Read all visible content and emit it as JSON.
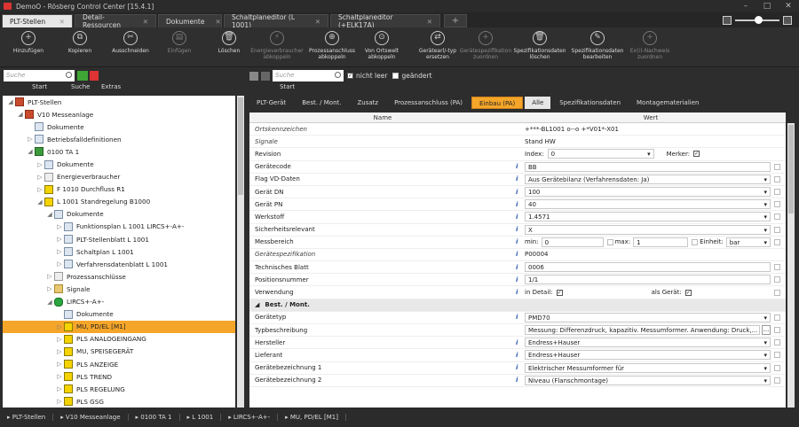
{
  "window": {
    "title": "DemoO - Rösberg Control Center [15.4.1]"
  },
  "tabs": [
    {
      "label": "PLT-Stellen"
    },
    {
      "label": "Detail-Ressourcen"
    },
    {
      "label": "Dokumente"
    },
    {
      "label": "Schaltplaneditor (L 1001)"
    },
    {
      "label": "Schaltplaneditor (+ELK17A)"
    }
  ],
  "toolbar": [
    {
      "label": "Hinzufügen",
      "icon": "plus-icon",
      "enabled": true
    },
    {
      "label": "Kopieren",
      "icon": "copy-icon",
      "enabled": true
    },
    {
      "label": "Ausschneiden",
      "icon": "scissors-icon",
      "enabled": true
    },
    {
      "label": "Einfügen",
      "icon": "paste-icon",
      "enabled": false
    },
    {
      "label": "Löschen",
      "icon": "trash-icon",
      "enabled": true
    },
    {
      "label": "Energieverbraucher abkoppeln",
      "icon": "energy-icon",
      "enabled": false
    },
    {
      "label": "Prozessanschluss abkoppeln",
      "icon": "process-icon",
      "enabled": true
    },
    {
      "label": "Von Ortswelt abkoppeln",
      "icon": "location-icon",
      "enabled": true
    },
    {
      "label": "Gerätearl/-typ ersetzen",
      "icon": "replace-icon",
      "enabled": true
    },
    {
      "label": "Gerätespezifikation zuordnen",
      "icon": "assign-icon",
      "enabled": false
    },
    {
      "label": "Spezifikationsdaten löschen",
      "icon": "spec-delete-icon",
      "enabled": true
    },
    {
      "label": "Spezifikationsdaten bearbeiten",
      "icon": "edit-icon",
      "enabled": true
    },
    {
      "label": "Ex(i)-Nachweis zuordnen",
      "icon": "ex-icon",
      "enabled": false
    }
  ],
  "left": {
    "search_placeholder": "Suche",
    "sub": [
      "Start",
      "Suche",
      "Extras"
    ]
  },
  "tree": [
    {
      "label": "PLT-Stellen",
      "depth": 0,
      "tw": "◢",
      "icon": "ic plant"
    },
    {
      "label": "V10 Messeanlage",
      "depth": 1,
      "tw": "◢",
      "icon": "ic plant"
    },
    {
      "label": "Dokumente",
      "depth": 2,
      "tw": "",
      "icon": "ic doc"
    },
    {
      "label": "Betriebsfalldefinitionen",
      "depth": 2,
      "tw": "▷",
      "icon": "ic doc"
    },
    {
      "label": "0100 TA 1",
      "depth": 2,
      "tw": "◢",
      "icon": "ic grn"
    },
    {
      "label": "Dokumente",
      "depth": 3,
      "tw": "▷",
      "icon": "ic doc"
    },
    {
      "label": "Energieverbraucher",
      "depth": 3,
      "tw": "▷",
      "icon": "ic"
    },
    {
      "label": "F 1010 Durchfluss R1",
      "depth": 3,
      "tw": "▷",
      "icon": "ic yel"
    },
    {
      "label": "L 1001 Standregelung B1000",
      "depth": 3,
      "tw": "◢",
      "icon": "ic yel"
    },
    {
      "label": "Dokumente",
      "depth": 4,
      "tw": "◢",
      "icon": "ic doc"
    },
    {
      "label": "Funktionsplan L 1001  LIRCS+-A+-",
      "depth": 5,
      "tw": "▷",
      "icon": "ic doc"
    },
    {
      "label": "PLT-Stellenblatt L 1001",
      "depth": 5,
      "tw": "▷",
      "icon": "ic doc"
    },
    {
      "label": "Schaltplan L 1001",
      "depth": 5,
      "tw": "▷",
      "icon": "ic doc"
    },
    {
      "label": "Verfahrensdatenblatt L 1001",
      "depth": 5,
      "tw": "▷",
      "icon": "ic doc"
    },
    {
      "label": "Prozessanschlüsse",
      "depth": 4,
      "tw": "▷",
      "icon": "ic"
    },
    {
      "label": "Signale",
      "depth": 4,
      "tw": "▷",
      "icon": "ic fld"
    },
    {
      "label": "LIRCS+-A+-",
      "depth": 4,
      "tw": "◢",
      "icon": "ic cloud"
    },
    {
      "label": "Dokumente",
      "depth": 5,
      "tw": "",
      "icon": "ic doc"
    },
    {
      "label": "MU, PD/EL [M1]",
      "depth": 5,
      "tw": "▷",
      "icon": "ic yel",
      "sel": true
    },
    {
      "label": "PLS ANALOGEINGANG",
      "depth": 5,
      "tw": "▷",
      "icon": "ic yel"
    },
    {
      "label": "MU, SPEISEGERÄT",
      "depth": 5,
      "tw": "▷",
      "icon": "ic yel"
    },
    {
      "label": "PLS ANZEIGE",
      "depth": 5,
      "tw": "▷",
      "icon": "ic yel"
    },
    {
      "label": "PLS TREND",
      "depth": 5,
      "tw": "▷",
      "icon": "ic yel"
    },
    {
      "label": "PLS REGELUNG",
      "depth": 5,
      "tw": "▷",
      "icon": "ic yel"
    },
    {
      "label": "PLS GSG",
      "depth": 5,
      "tw": "▷",
      "icon": "ic yel"
    }
  ],
  "right": {
    "search_placeholder": "Suche",
    "nicht_leer": "nicht leer",
    "geaendert": "geändert",
    "start": "Start",
    "tabs": [
      "PLT-Gerät",
      "Best. / Mont.",
      "Zusatz",
      "Prozessanschluss (PA)",
      "Einbau (PA)",
      "Alle",
      "Spezifikationsdaten",
      "Montagematerialien"
    ],
    "col_name": "Name",
    "col_wert": "Wert"
  },
  "rows": [
    {
      "name": "Ortskennzeichen",
      "italic": true,
      "value": "+***-BL1001 o--o +*V01*-X01",
      "type": "text"
    },
    {
      "name": "Signale",
      "italic": true,
      "value": "Stand HW",
      "type": "text"
    },
    {
      "name": "Revision",
      "value": "0",
      "pre": "Index:",
      "type": "dd",
      "post": "Merker:",
      "postchk": true
    },
    {
      "name": "Gerätecode",
      "info": true,
      "value": "BB",
      "type": "box"
    },
    {
      "name": "Flag VD-Daten",
      "info": true,
      "value": "Aus Gerätebilanz (Verfahrensdaten: Ja)",
      "type": "dd"
    },
    {
      "name": "Gerät DN",
      "info": true,
      "value": "100",
      "type": "dd"
    },
    {
      "name": "Gerät PN",
      "info": true,
      "value": "40",
      "type": "dd"
    },
    {
      "name": "Werkstoff",
      "info": true,
      "value": "1.4571",
      "type": "dd"
    },
    {
      "name": "Sicherheitsrelevant",
      "info": true,
      "value": "X",
      "type": "dd"
    },
    {
      "name": "Messbereich",
      "info": true,
      "type": "range",
      "min": "0",
      "max": "1",
      "unit": "bar",
      "l_min": "min:",
      "l_max": "max:",
      "l_unit": "Einheit:"
    },
    {
      "name": "Gerätespezifikation",
      "italic": true,
      "info": true,
      "value": "P00004",
      "type": "text"
    },
    {
      "name": "Technisches Blatt",
      "info": true,
      "value": "0006",
      "type": "box"
    },
    {
      "name": "Positionsnummer",
      "info": true,
      "value": "1/1",
      "type": "box"
    },
    {
      "name": "Verwendung",
      "info": true,
      "type": "use",
      "l1": "in Detail:",
      "l2": "als Gerät:"
    },
    {
      "name": "Best. / Mont.",
      "type": "section"
    },
    {
      "name": "Gerätetyp",
      "info": true,
      "value": "PMD70",
      "type": "dd"
    },
    {
      "name": "Typbeschreibung",
      "value": "Messung: Differenzdruck, kapazitiv. Messumformer. Anwendung: Druck,...",
      "type": "box",
      "dots": true
    },
    {
      "name": "Hersteller",
      "info": true,
      "value": "Endress+Hauser",
      "type": "dd"
    },
    {
      "name": "Lieferant",
      "info": true,
      "value": "Endress+Hauser",
      "type": "dd"
    },
    {
      "name": "Gerätebezeichnung 1",
      "info": true,
      "value": "Elektrischer Messumformer für",
      "type": "dd"
    },
    {
      "name": "Gerätebezeichnung 2",
      "info": true,
      "value": "Niveau (Flanschmontage)",
      "type": "dd"
    }
  ],
  "statusbar": [
    "PLT-Stellen",
    "V10 Messeanlage",
    "0100 TA 1",
    "L 1001",
    "LIRCS+-A+-",
    "MU, PD/EL [M1]"
  ]
}
